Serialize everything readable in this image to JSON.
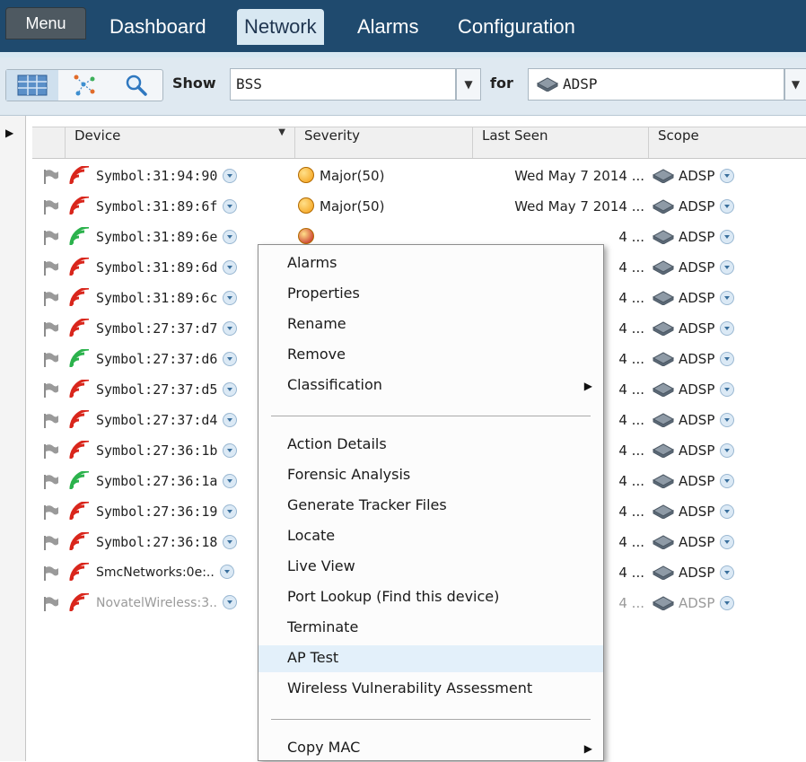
{
  "nav": {
    "menu": "Menu",
    "tabs": [
      {
        "label": "Dashboard"
      },
      {
        "label": "Network"
      },
      {
        "label": "Alarms"
      },
      {
        "label": "Configuration"
      }
    ],
    "active_tab": "Network"
  },
  "toolbar": {
    "views": [
      {
        "icon": "table-view-icon",
        "active": true
      },
      {
        "icon": "topology-view-icon",
        "active": false
      },
      {
        "icon": "search-icon",
        "active": false
      }
    ],
    "show_label": "Show",
    "show_value": "BSS",
    "for_label": "for",
    "for_value": "ADSP"
  },
  "grid": {
    "columns": {
      "device": "Device",
      "severity": "Severity",
      "last_seen": "Last Seen",
      "scope": "Scope"
    },
    "rows": [
      {
        "device": "Symbol:31:94:90",
        "signal": "red",
        "severity": "Major(50)",
        "severity_color": "#f39c12",
        "last_seen": "Wed May 7 2014 ...",
        "scope": "ADSP"
      },
      {
        "device": "Symbol:31:89:6f",
        "signal": "red",
        "severity": "Major(50)",
        "severity_color": "#f39c12",
        "last_seen": "Wed May 7 2014 ...",
        "scope": "ADSP"
      },
      {
        "device": "Symbol:31:89:6e",
        "signal": "green",
        "severity": "",
        "severity_color": "#c0161b",
        "last_seen": "4 ...",
        "scope": "ADSP"
      },
      {
        "device": "Symbol:31:89:6d",
        "signal": "red",
        "severity": "",
        "severity_color": "",
        "last_seen": "4 ...",
        "scope": "ADSP"
      },
      {
        "device": "Symbol:31:89:6c",
        "signal": "red",
        "severity": "",
        "severity_color": "",
        "last_seen": "4 ...",
        "scope": "ADSP"
      },
      {
        "device": "Symbol:27:37:d7",
        "signal": "red",
        "severity": "",
        "severity_color": "",
        "last_seen": "4 ...",
        "scope": "ADSP"
      },
      {
        "device": "Symbol:27:37:d6",
        "signal": "green",
        "severity": "",
        "severity_color": "",
        "last_seen": "4 ...",
        "scope": "ADSP"
      },
      {
        "device": "Symbol:27:37:d5",
        "signal": "red",
        "severity": "",
        "severity_color": "",
        "last_seen": "4 ...",
        "scope": "ADSP"
      },
      {
        "device": "Symbol:27:37:d4",
        "signal": "red",
        "severity": "",
        "severity_color": "",
        "last_seen": "4 ...",
        "scope": "ADSP"
      },
      {
        "device": "Symbol:27:36:1b",
        "signal": "red",
        "severity": "",
        "severity_color": "",
        "last_seen": "4 ...",
        "scope": "ADSP"
      },
      {
        "device": "Symbol:27:36:1a",
        "signal": "green",
        "severity": "",
        "severity_color": "",
        "last_seen": "4 ...",
        "scope": "ADSP"
      },
      {
        "device": "Symbol:27:36:19",
        "signal": "red",
        "severity": "",
        "severity_color": "",
        "last_seen": "4 ...",
        "scope": "ADSP"
      },
      {
        "device": "Symbol:27:36:18",
        "signal": "red",
        "severity": "",
        "severity_color": "",
        "last_seen": "4 ...",
        "scope": "ADSP"
      },
      {
        "device": "SmcNetworks:0e:..",
        "signal": "red",
        "severity": "",
        "severity_color": "",
        "last_seen": "4 ...",
        "scope": "ADSP"
      },
      {
        "device": "NovatelWireless:3..",
        "signal": "red",
        "severity": "",
        "severity_color": "",
        "last_seen": "4 ...",
        "scope": "ADSP",
        "dim": true
      }
    ]
  },
  "context_menu": {
    "items": [
      {
        "label": "Alarms"
      },
      {
        "label": "Properties"
      },
      {
        "label": "Rename"
      },
      {
        "label": "Remove"
      },
      {
        "label": "Classification",
        "submenu": true
      },
      {
        "separator": true
      },
      {
        "label": "Action Details"
      },
      {
        "label": "Forensic Analysis"
      },
      {
        "label": "Generate Tracker Files"
      },
      {
        "label": "Locate"
      },
      {
        "label": "Live View"
      },
      {
        "label": "Port Lookup (Find this device)"
      },
      {
        "label": "Terminate"
      },
      {
        "label": "AP Test",
        "highlighted": true
      },
      {
        "label": "Wireless Vulnerability Assessment"
      },
      {
        "separator": true
      },
      {
        "label": "Copy MAC",
        "submenu": true
      }
    ]
  },
  "colors": {
    "nav_bg": "#1f4a6e",
    "signal_red": "#d9261c",
    "signal_green": "#2bb24c",
    "menu_highlight": "#e3f0fa"
  }
}
